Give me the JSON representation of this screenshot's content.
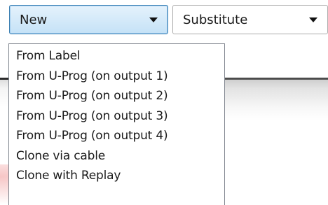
{
  "toolbar": {
    "new_combo": {
      "value": "New"
    },
    "substitute_combo": {
      "value": "Substitute"
    }
  },
  "menu": {
    "items": [
      {
        "label": "From Label"
      },
      {
        "label": "From U-Prog (on output 1)"
      },
      {
        "label": "From U-Prog (on output 2)"
      },
      {
        "label": "From U-Prog (on output 3)"
      },
      {
        "label": "From U-Prog (on output 4)"
      },
      {
        "label": "Clone via cable"
      },
      {
        "label": "Clone with Replay"
      }
    ]
  },
  "colors": {
    "combo_active_fill": "#c5e2f7",
    "combo_active_border": "#3c7fb1",
    "menu_border": "#828790"
  }
}
